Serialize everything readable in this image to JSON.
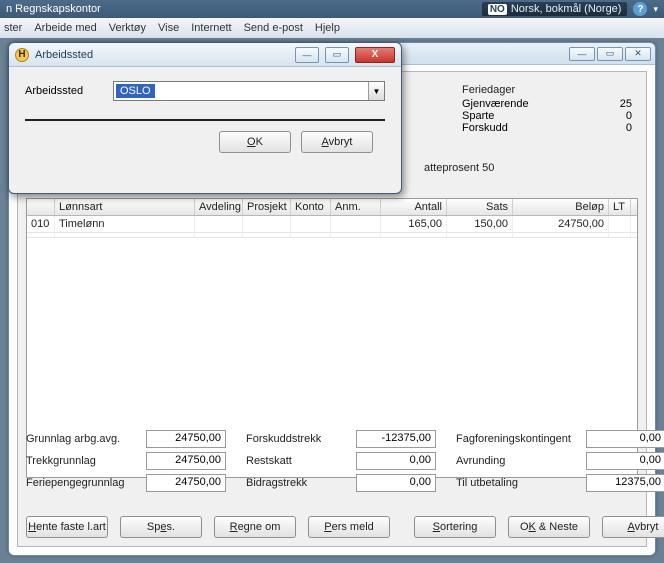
{
  "app": {
    "title": "n Regnskapskontor",
    "language_kbd": "NO",
    "language_label": "Norsk, bokmål (Norge)"
  },
  "menu": {
    "items": [
      "ster",
      "Arbeide med",
      "Verktøy",
      "Vise",
      "Internett",
      "Send e-post",
      "Hjelp"
    ]
  },
  "dialog": {
    "title": "Arbeidssted",
    "field_label": "Arbeidssted",
    "selected": "OSLO",
    "ok": "OK",
    "cancel": "Avbryt"
  },
  "ferie": {
    "header": "Feriedager",
    "rows": [
      {
        "label": "Gjenværende",
        "value": "25"
      },
      {
        "label": "Sparte",
        "value": "0"
      },
      {
        "label": "Forskudd",
        "value": "0"
      }
    ]
  },
  "skatt_text": "atteprosent 50",
  "grid": {
    "headers": {
      "num": "",
      "art": "Lønnsart",
      "avd": "Avdeling",
      "pro": "Prosjekt",
      "kto": "Konto",
      "anm": "Anm.",
      "ant": "Antall",
      "sat": "Sats",
      "bel": "Beløp",
      "lt": "LT"
    },
    "rows": [
      {
        "num": "010",
        "art": "Timelønn",
        "avd": "",
        "pro": "",
        "kto": "",
        "anm": "",
        "ant": "165,00",
        "sat": "150,00",
        "bel": "24750,00",
        "lt": ""
      }
    ]
  },
  "totals": {
    "r1": {
      "l1": "Grunnlag arbg.avg.",
      "v1": "24750,00",
      "l2": "Forskuddstrekk",
      "v2": "-12375,00",
      "l3": "Fagforeningskontingent",
      "v3": "0,00"
    },
    "r2": {
      "l1": "Trekkgrunnlag",
      "v1": "24750,00",
      "l2": "Restskatt",
      "v2": "0,00",
      "l3": "Avrunding",
      "v3": "0,00"
    },
    "r3": {
      "l1": "Feriepengegrunnlag",
      "v1": "24750,00",
      "l2": "Bidragstrekk",
      "v2": "0,00",
      "l3": "Til utbetaling",
      "v3": "12375,00"
    }
  },
  "buttons": {
    "b1": "Hente faste l.art",
    "b2": "Spes.",
    "b3": "Regne om",
    "b4": "Pers meld",
    "b5": "Sortering",
    "b6": "OK & Neste",
    "b7": "Avbryt"
  }
}
